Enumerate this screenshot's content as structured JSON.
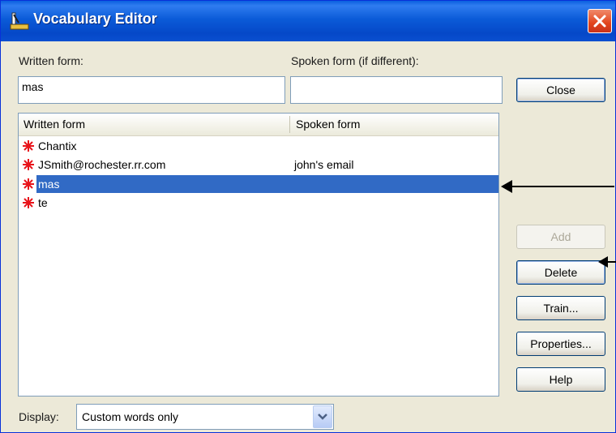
{
  "window": {
    "title": "Vocabulary Editor",
    "title_bar_color": "#0a5fe0",
    "close_icon": "close-x-icon",
    "app_icon": "vocabulary-editor-icon"
  },
  "written_form": {
    "label": "Written form:",
    "value": "mas"
  },
  "spoken_form": {
    "label": "Spoken form (if different):",
    "value": ""
  },
  "buttons": {
    "close": "Close",
    "add": "Add",
    "delete": "Delete",
    "train": "Train...",
    "properties": "Properties...",
    "help": "Help"
  },
  "list": {
    "columns": [
      "Written form",
      "Spoken form"
    ],
    "rows": [
      {
        "written": "Chantix",
        "spoken": "",
        "icon": "custom-word-icon",
        "selected": false
      },
      {
        "written": "JSmith@rochester.rr.com",
        "spoken": "john's email",
        "icon": "custom-word-icon",
        "selected": true
      },
      {
        "written": "mas",
        "spoken": "",
        "icon": "custom-word-icon",
        "selected": true
      },
      {
        "written": "te",
        "spoken": "",
        "icon": "custom-word-icon",
        "selected": false
      }
    ],
    "selection_color": "#316ac5"
  },
  "display": {
    "label": "Display:",
    "value": "Custom words only"
  }
}
